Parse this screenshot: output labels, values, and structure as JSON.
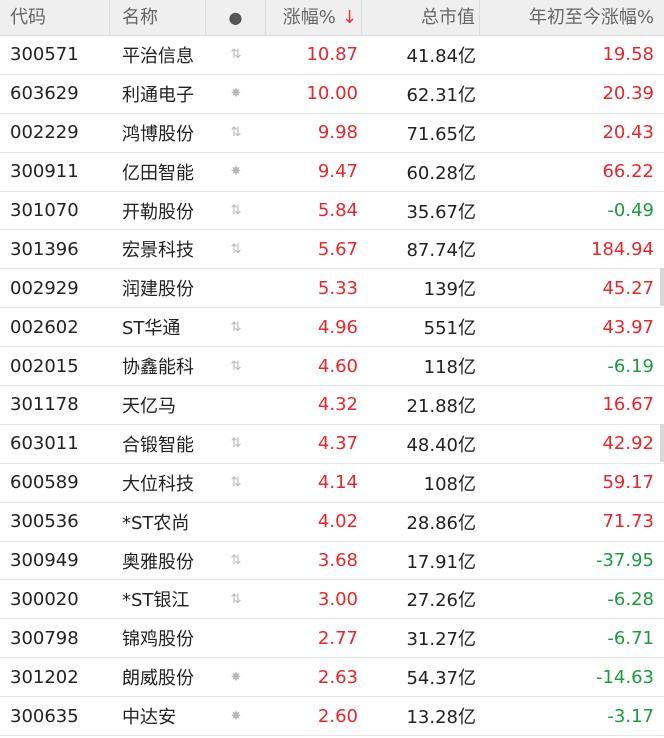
{
  "header": {
    "code": "代码",
    "name": "名称",
    "dot": "●",
    "change": "涨幅%",
    "sort_icon": "↓",
    "market_cap": "总市值",
    "ytd": "年初至今涨幅%"
  },
  "colors": {
    "up": "#e8262c",
    "down": "#1a9c3e",
    "header_bg": "#efefef"
  },
  "rows": [
    {
      "code": "300571",
      "name": "平治信息",
      "flag": "arrows-icon",
      "change": "10.87",
      "market_cap": "41.84亿",
      "ytd": "19.58",
      "ytd_dir": "up"
    },
    {
      "code": "603629",
      "name": "利通电子",
      "flag": "star-icon",
      "change": "10.00",
      "market_cap": "62.31亿",
      "ytd": "20.39",
      "ytd_dir": "up"
    },
    {
      "code": "002229",
      "name": "鸿博股份",
      "flag": "arrows-icon",
      "change": "9.98",
      "market_cap": "71.65亿",
      "ytd": "20.43",
      "ytd_dir": "up"
    },
    {
      "code": "300911",
      "name": "亿田智能",
      "flag": "star-icon",
      "change": "9.47",
      "market_cap": "60.28亿",
      "ytd": "66.22",
      "ytd_dir": "up"
    },
    {
      "code": "301070",
      "name": "开勒股份",
      "flag": "arrows-icon",
      "change": "5.84",
      "market_cap": "35.67亿",
      "ytd": "-0.49",
      "ytd_dir": "down"
    },
    {
      "code": "301396",
      "name": "宏景科技",
      "flag": "arrows-icon",
      "change": "5.67",
      "market_cap": "87.74亿",
      "ytd": "184.94",
      "ytd_dir": "up"
    },
    {
      "code": "002929",
      "name": "润建股份",
      "flag": "",
      "change": "5.33",
      "market_cap": "139亿",
      "ytd": "45.27",
      "ytd_dir": "up"
    },
    {
      "code": "002602",
      "name": "ST华通",
      "flag": "arrows-icon",
      "change": "4.96",
      "market_cap": "551亿",
      "ytd": "43.97",
      "ytd_dir": "up"
    },
    {
      "code": "002015",
      "name": "协鑫能科",
      "flag": "arrows-icon",
      "change": "4.60",
      "market_cap": "118亿",
      "ytd": "-6.19",
      "ytd_dir": "down"
    },
    {
      "code": "301178",
      "name": "天亿马",
      "flag": "",
      "change": "4.32",
      "market_cap": "21.88亿",
      "ytd": "16.67",
      "ytd_dir": "up"
    },
    {
      "code": "603011",
      "name": "合锻智能",
      "flag": "arrows-icon",
      "change": "4.37",
      "market_cap": "48.40亿",
      "ytd": "42.92",
      "ytd_dir": "up"
    },
    {
      "code": "600589",
      "name": "大位科技",
      "flag": "arrows-icon",
      "change": "4.14",
      "market_cap": "108亿",
      "ytd": "59.17",
      "ytd_dir": "up"
    },
    {
      "code": "300536",
      "name": "*ST农尚",
      "flag": "",
      "change": "4.02",
      "market_cap": "28.86亿",
      "ytd": "71.73",
      "ytd_dir": "up"
    },
    {
      "code": "300949",
      "name": "奥雅股份",
      "flag": "arrows-icon",
      "change": "3.68",
      "market_cap": "17.91亿",
      "ytd": "-37.95",
      "ytd_dir": "down"
    },
    {
      "code": "300020",
      "name": "*ST银江",
      "flag": "arrows-icon",
      "change": "3.00",
      "market_cap": "27.26亿",
      "ytd": "-6.28",
      "ytd_dir": "down"
    },
    {
      "code": "300798",
      "name": "锦鸡股份",
      "flag": "",
      "change": "2.77",
      "market_cap": "31.27亿",
      "ytd": "-6.71",
      "ytd_dir": "down"
    },
    {
      "code": "301202",
      "name": "朗威股份",
      "flag": "star-icon",
      "change": "2.63",
      "market_cap": "54.37亿",
      "ytd": "-14.63",
      "ytd_dir": "down"
    },
    {
      "code": "300635",
      "name": "中达安",
      "flag": "star-icon",
      "change": "2.60",
      "market_cap": "13.28亿",
      "ytd": "-3.17",
      "ytd_dir": "down"
    }
  ]
}
